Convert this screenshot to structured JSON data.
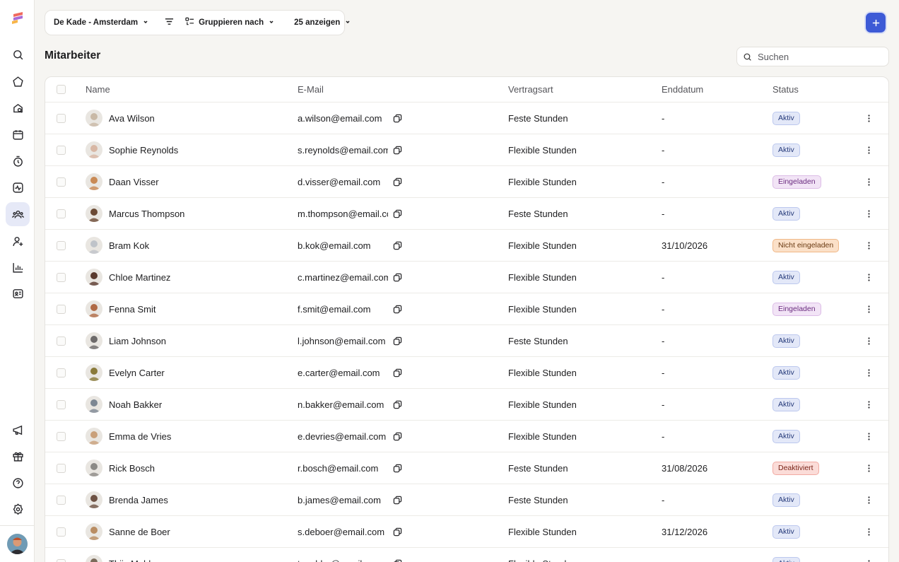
{
  "toolbar": {
    "location": "De Kade - Amsterdam",
    "group_by": "Gruppieren nach",
    "show": "25 anzeigen"
  },
  "page": {
    "title": "Mitarbeiter"
  },
  "search": {
    "placeholder": "Suchen"
  },
  "table": {
    "headers": {
      "name": "Name",
      "email": "E-Mail",
      "contract": "Vertragsart",
      "end_date": "Enddatum",
      "status": "Status"
    },
    "rows": [
      {
        "name": "Ava Wilson",
        "email": "a.wilson@email.com",
        "contract": "Feste Stunden",
        "end_date": "-",
        "status": "Aktiv",
        "status_kind": "aktiv",
        "avatar_color": "#c9b9a6"
      },
      {
        "name": "Sophie Reynolds",
        "email": "s.reynolds@email.com",
        "contract": "Flexible Stunden",
        "end_date": "-",
        "status": "Aktiv",
        "status_kind": "aktiv",
        "avatar_color": "#d8b7a4"
      },
      {
        "name": "Daan Visser",
        "email": "d.visser@email.com",
        "contract": "Flexible Stunden",
        "end_date": "-",
        "status": "Eingeladen",
        "status_kind": "eing",
        "avatar_color": "#c98a55"
      },
      {
        "name": "Marcus Thompson",
        "email": "m.thompson@email.com",
        "contract": "Feste Stunden",
        "end_date": "-",
        "status": "Aktiv",
        "status_kind": "aktiv",
        "avatar_color": "#6b4a35"
      },
      {
        "name": "Bram Kok",
        "email": "b.kok@email.com",
        "contract": "Flexible Stunden",
        "end_date": "31/10/2026",
        "status": "Nicht eingeladen",
        "status_kind": "nicht",
        "avatar_color": "#bfc3c9"
      },
      {
        "name": "Chloe Martinez",
        "email": "c.martinez@email.com",
        "contract": "Flexible Stunden",
        "end_date": "-",
        "status": "Aktiv",
        "status_kind": "aktiv",
        "avatar_color": "#5a3a2e"
      },
      {
        "name": "Fenna Smit",
        "email": "f.smit@email.com",
        "contract": "Flexible Stunden",
        "end_date": "-",
        "status": "Eingeladen",
        "status_kind": "eing",
        "avatar_color": "#b06a45"
      },
      {
        "name": "Liam Johnson",
        "email": "l.johnson@email.com",
        "contract": "Feste Stunden",
        "end_date": "-",
        "status": "Aktiv",
        "status_kind": "aktiv",
        "avatar_color": "#6d6a6a"
      },
      {
        "name": "Evelyn Carter",
        "email": "e.carter@email.com",
        "contract": "Flexible Stunden",
        "end_date": "-",
        "status": "Aktiv",
        "status_kind": "aktiv",
        "avatar_color": "#8a7a3a"
      },
      {
        "name": "Noah Bakker",
        "email": "n.bakker@email.com",
        "contract": "Flexible Stunden",
        "end_date": "-",
        "status": "Aktiv",
        "status_kind": "aktiv",
        "avatar_color": "#7d8793"
      },
      {
        "name": "Emma de Vries",
        "email": "e.devries@email.com",
        "contract": "Flexible Stunden",
        "end_date": "-",
        "status": "Aktiv",
        "status_kind": "aktiv",
        "avatar_color": "#c9a07a"
      },
      {
        "name": "Rick Bosch",
        "email": "r.bosch@email.com",
        "contract": "Feste Stunden",
        "end_date": "31/08/2026",
        "status": "Deaktiviert",
        "status_kind": "deakt",
        "avatar_color": "#8c8a86"
      },
      {
        "name": "Brenda James",
        "email": "b.james@email.com",
        "contract": "Feste Stunden",
        "end_date": "-",
        "status": "Aktiv",
        "status_kind": "aktiv",
        "avatar_color": "#6e5244"
      },
      {
        "name": "Sanne de Boer",
        "email": "s.deboer@email.com",
        "contract": "Flexible Stunden",
        "end_date": "31/12/2026",
        "status": "Aktiv",
        "status_kind": "aktiv",
        "avatar_color": "#b98d63"
      },
      {
        "name": "Thijs Mulder",
        "email": "t.mulder@email.com",
        "contract": "Flexible Stunden",
        "end_date": "-",
        "status": "Aktiv",
        "status_kind": "aktiv",
        "avatar_color": "#7a6a5a"
      }
    ]
  },
  "colors": {
    "accent": "#3d5ad6",
    "background": "#f6f5f2"
  },
  "sidebar": {
    "icons": [
      "search-icon",
      "home-icon",
      "search-location-icon",
      "calendar-icon",
      "clock-icon",
      "activity-icon",
      "team-icon",
      "add-person-icon",
      "chart-icon",
      "id-card-icon",
      "megaphone-icon",
      "gift-icon",
      "help-icon",
      "settings-icon"
    ]
  }
}
